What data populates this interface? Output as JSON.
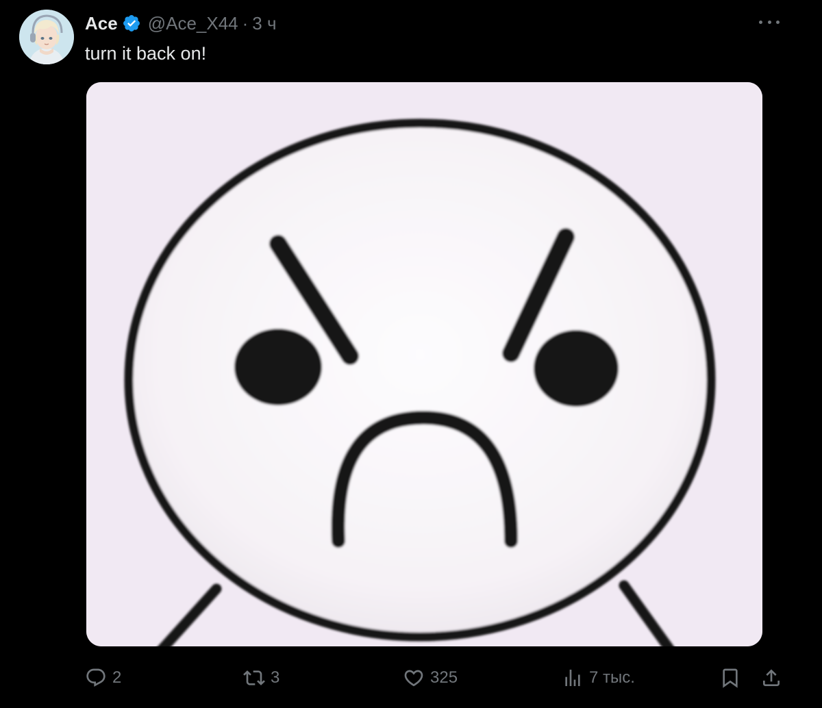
{
  "tweet": {
    "author": {
      "display_name": "Ace",
      "verified": true,
      "handle": "@Ace_X44",
      "separator": "·",
      "time": "3 ч",
      "avatar_icon": "anime-avatar-icon"
    },
    "text": "turn it back on!",
    "media_description_icon": "angry-face-drawing"
  },
  "actions": {
    "reply_count": "2",
    "retweet_count": "3",
    "like_count": "325",
    "views_count": "7 тыс."
  },
  "colors": {
    "background": "#000000",
    "text_primary": "#e7e9ea",
    "text_secondary": "#71767b",
    "verified": "#1d9bf0",
    "media_background": "#f1e9f3"
  }
}
